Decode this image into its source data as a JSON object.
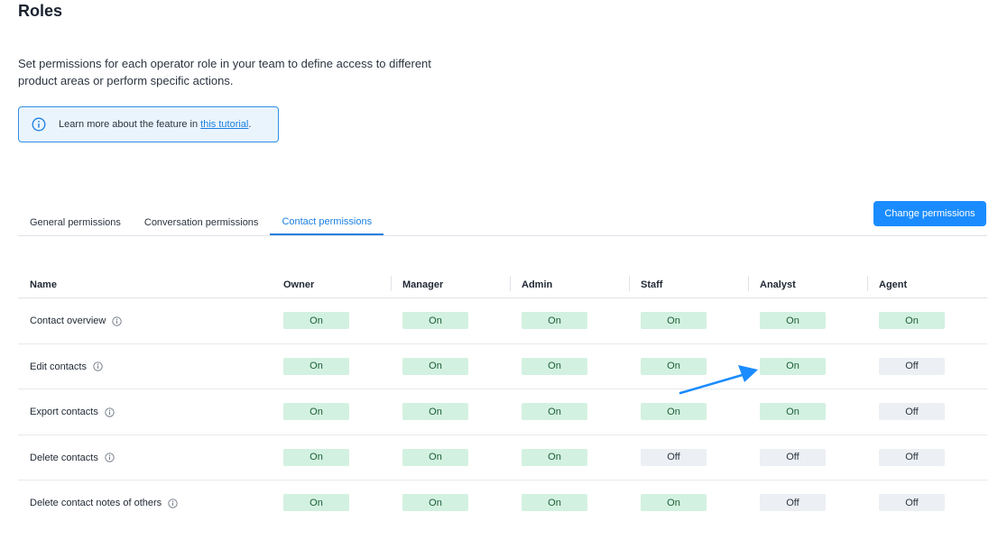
{
  "page": {
    "title": "Roles",
    "description": "Set permissions for each operator role in your team to define access to different product areas or perform specific actions."
  },
  "info": {
    "text": "Learn more about the feature in ",
    "link": "this tutorial",
    "suffix": "."
  },
  "tabs": [
    {
      "label": "General permissions",
      "active": false
    },
    {
      "label": "Conversation permissions",
      "active": false
    },
    {
      "label": "Contact permissions",
      "active": true
    }
  ],
  "actions": {
    "change_permissions": "Change permissions"
  },
  "table": {
    "headers": [
      "Name",
      "Owner",
      "Manager",
      "Admin",
      "Staff",
      "Analyst",
      "Agent"
    ],
    "rows": [
      {
        "name": "Contact overview",
        "values": [
          "On",
          "On",
          "On",
          "On",
          "On",
          "On"
        ]
      },
      {
        "name": "Edit contacts",
        "values": [
          "On",
          "On",
          "On",
          "On",
          "On",
          "Off"
        ]
      },
      {
        "name": "Export contacts",
        "values": [
          "On",
          "On",
          "On",
          "On",
          "On",
          "Off"
        ]
      },
      {
        "name": "Delete contacts",
        "values": [
          "On",
          "On",
          "On",
          "Off",
          "Off",
          "Off"
        ]
      },
      {
        "name": "Delete contact notes of others",
        "values": [
          "On",
          "On",
          "On",
          "On",
          "Off",
          "Off"
        ]
      }
    ]
  },
  "colors": {
    "accent": "#1a8cff",
    "on_bg": "#d3f1e0",
    "off_bg": "#eceff3",
    "annotation_arrow": "#1a8cff"
  }
}
